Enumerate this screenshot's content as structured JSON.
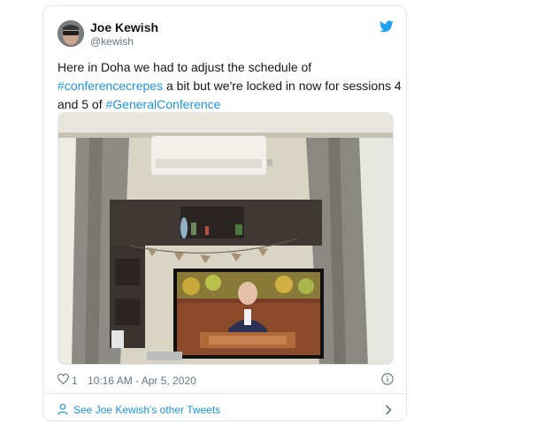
{
  "tweet": {
    "author": {
      "name": "Joe Kewish",
      "handle": "@kewish"
    },
    "text": {
      "line1": "Here in Doha we had to adjust the schedule of",
      "hashtag1": "#conferencecrepes",
      "line2_rest": " a bit but we're locked in now for sessions 4",
      "line3_start": "and 5 of ",
      "hashtag2": "#GeneralConference"
    },
    "likes": "1",
    "timestamp": "10:16 AM - Apr 5, 2020"
  },
  "footer": {
    "link_label": "See Joe Kewish's other Tweets"
  },
  "colors": {
    "link": "#1b95e0",
    "muted": "#657786",
    "border": "#e1e8ed",
    "text": "#14171a"
  },
  "icons": [
    "twitter-bird-icon",
    "heart-icon",
    "info-icon",
    "person-icon",
    "chevron-right-icon"
  ]
}
